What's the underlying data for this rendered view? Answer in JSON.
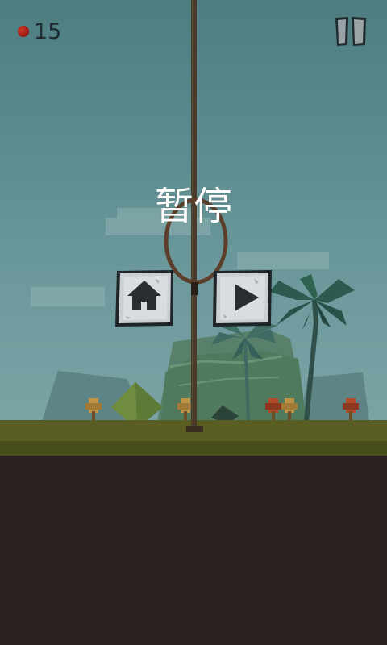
{
  "hud": {
    "score_icon": "berry-icon",
    "score": "15",
    "pause_icon": "pause-icon"
  },
  "pause_menu": {
    "title": "暂停",
    "home_icon": "home-icon",
    "resume_icon": "play-icon"
  },
  "colors": {
    "sky_top": "#4e7d80",
    "sky_bottom": "#7aa3a5",
    "grass": "#5a5e22",
    "soil": "#2a2320",
    "rope": "#4a3a2a",
    "berry": "#a01a12"
  }
}
